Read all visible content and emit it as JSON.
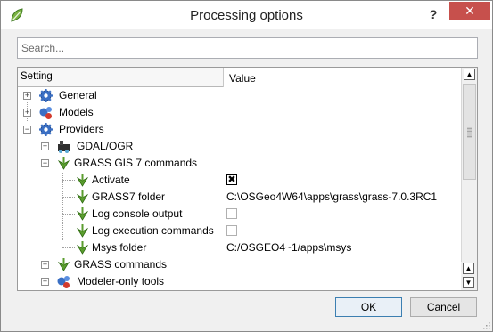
{
  "window": {
    "title": "Processing options",
    "help_label": "?",
    "close_label": "✕"
  },
  "search": {
    "placeholder": "Search...",
    "value": ""
  },
  "tree": {
    "columns": [
      "Setting",
      "Value"
    ],
    "nodes": {
      "general": "General",
      "models": "Models",
      "providers": "Providers",
      "gdal_ogr": "GDAL/OGR",
      "grass7": "GRASS GIS 7 commands",
      "activate": "Activate",
      "activate_checked": true,
      "grass7_folder": "GRASS7 folder",
      "grass7_folder_value": "C:\\OSGeo4W64\\apps\\grass\\grass-7.0.3RC1",
      "log_console": "Log console output",
      "log_console_checked": false,
      "log_exec": "Log execution commands",
      "log_exec_checked": false,
      "msys_folder": "Msys folder",
      "msys_folder_value": "C:/OSGEO4~1/apps\\msys",
      "grass": "GRASS commands",
      "modeler": "Modeler-only tools"
    },
    "expander_collapsed": "+",
    "expander_expanded": "−",
    "check_mark": "✖"
  },
  "buttons": {
    "ok": "OK",
    "cancel": "Cancel"
  },
  "colors": {
    "gear_blue": "#3a6fc4",
    "leaf_green": "#5b9e2f",
    "close_red": "#c7504c"
  },
  "icons": {
    "app": "qgis-leaf-icon",
    "general": "gear-icon",
    "models": "models-icon",
    "providers": "gear-icon",
    "gdal": "gdal-icon",
    "grass": "grass-icon",
    "modeler": "models-icon"
  }
}
